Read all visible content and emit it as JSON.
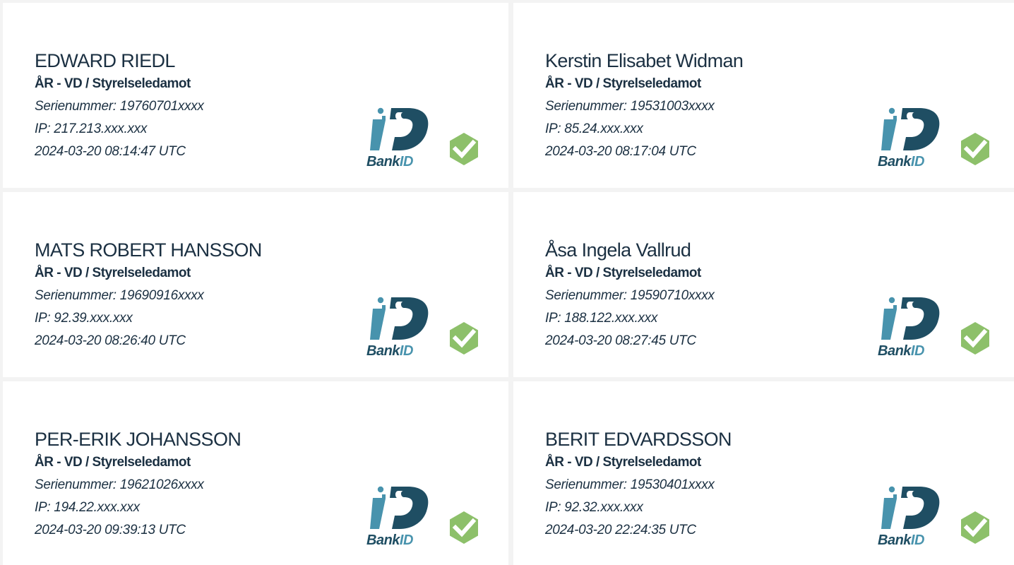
{
  "colors": {
    "page_background": "#f3f3f3",
    "card_background": "#ffffff",
    "text": "#1b3042",
    "bankid_dark": "#1f4e63",
    "bankid_light": "#4893ad",
    "check_green": "#8dc06a"
  },
  "icons": {
    "bankid": "bankid-logo",
    "verified": "check-badge-icon"
  },
  "bankid_text": {
    "bank": "Bank",
    "id": "ID"
  },
  "signers": [
    {
      "name": "EDWARD RIEDL",
      "role": "ÅR - VD / Styrelseledamot",
      "serial": "Serienummer: 19760701xxxx",
      "ip": "IP: 217.213.xxx.xxx",
      "timestamp": "2024-03-20 08:14:47 UTC"
    },
    {
      "name": "Kerstin Elisabet Widman",
      "role": "ÅR - VD / Styrelseledamot",
      "serial": "Serienummer: 19531003xxxx",
      "ip": "IP: 85.24.xxx.xxx",
      "timestamp": "2024-03-20 08:17:04 UTC"
    },
    {
      "name": "MATS ROBERT HANSSON",
      "role": "ÅR - VD / Styrelseledamot",
      "serial": "Serienummer: 19690916xxxx",
      "ip": "IP: 92.39.xxx.xxx",
      "timestamp": "2024-03-20 08:26:40 UTC"
    },
    {
      "name": "Åsa Ingela Vallrud",
      "role": "ÅR - VD / Styrelseledamot",
      "serial": "Serienummer: 19590710xxxx",
      "ip": "IP: 188.122.xxx.xxx",
      "timestamp": "2024-03-20 08:27:45 UTC"
    },
    {
      "name": "PER-ERIK JOHANSSON",
      "role": "ÅR - VD / Styrelseledamot",
      "serial": "Serienummer: 19621026xxxx",
      "ip": "IP: 194.22.xxx.xxx",
      "timestamp": "2024-03-20 09:39:13 UTC"
    },
    {
      "name": "BERIT EDVARDSSON",
      "role": "ÅR - VD / Styrelseledamot",
      "serial": "Serienummer: 19530401xxxx",
      "ip": "IP: 92.32.xxx.xxx",
      "timestamp": "2024-03-20 22:24:35 UTC"
    }
  ]
}
